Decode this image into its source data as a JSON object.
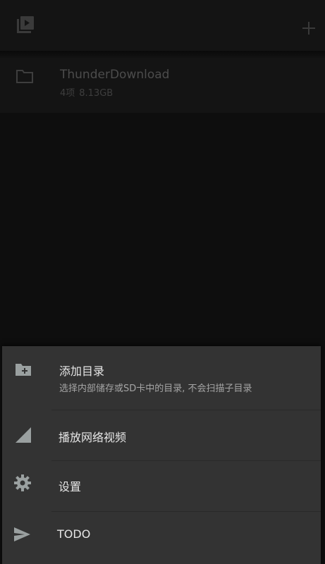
{
  "toolbar": {
    "app_icon": "video-library-icon",
    "add_icon": "plus-icon"
  },
  "folders": [
    {
      "name": "ThunderDownload",
      "count": "4项",
      "size": "8.13GB",
      "icon": "folder-icon"
    }
  ],
  "sheet": {
    "items": [
      {
        "title": "添加目录",
        "subtitle": "选择内部储存或SD卡中的目录, 不会扫描子目录",
        "icon": "folder-plus-icon"
      },
      {
        "title": "播放网络视频",
        "icon": "signal-icon"
      },
      {
        "title": "设置",
        "icon": "gear-icon"
      },
      {
        "title": "TODO",
        "icon": "send-icon"
      }
    ]
  },
  "colors": {
    "background": "#0e0e0e",
    "toolbar": "#141414",
    "sheet": "#333333",
    "sheet_text": "#e6e6e6",
    "sheet_subtext": "#a5a5a5"
  }
}
